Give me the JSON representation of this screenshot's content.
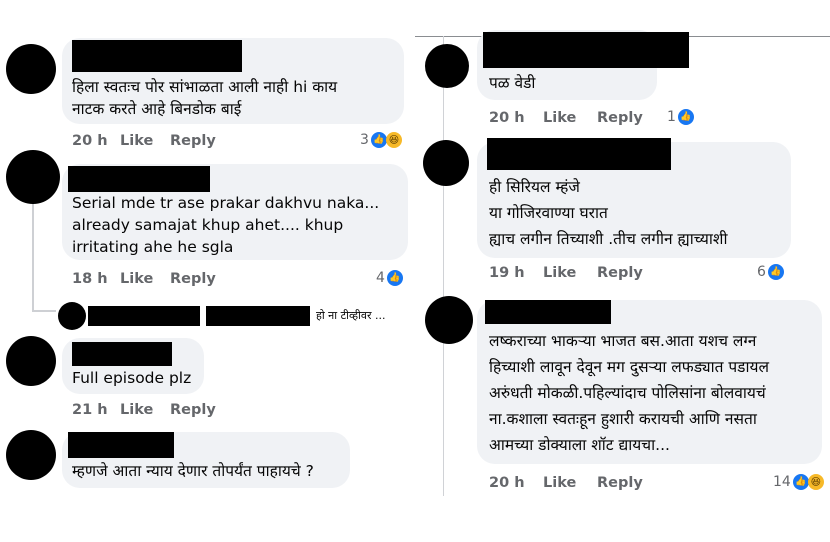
{
  "actions": {
    "like": "Like",
    "reply": "Reply"
  },
  "icons": {
    "like": "like-reaction-icon",
    "haha": "haha-reaction-icon"
  },
  "left_comments": [
    {
      "lines": [
        "हिला स्वतःच पोर सांभाळता आली नाही hi काय",
        "नाटक करते आहे बिनडोक बाई"
      ],
      "time": "20 h",
      "reactions": "3"
    },
    {
      "lines": [
        "Serial mde tr ase prakar dakhvu naka...",
        "already samajat khup ahet.... khup",
        "irritating ahe he sgla"
      ],
      "time": "18 h",
      "reactions": "4"
    },
    {
      "reply_snippet": "हो ना टीव्हीवर ..."
    },
    {
      "lines": [
        "Full episode plz"
      ],
      "time": "21 h"
    },
    {
      "lines": [
        "म्हणजे आता न्याय देणार तोपर्यंत पाहायचे ?"
      ]
    }
  ],
  "right_comments": [
    {
      "lines": [
        "पळ वेडी"
      ],
      "time": "20 h",
      "reactions": "1"
    },
    {
      "lines": [
        "ही सिरियल म्हंजे",
        "या गोजिरवाण्या घरात",
        "ह्याच लगीन तिच्याशी .तीच लगीन ह्याच्याशी"
      ],
      "time": "19 h",
      "reactions": "6"
    },
    {
      "lines": [
        "लष्कराच्या भाकऱ्या भाजत बस.आता यशच लग्न",
        "हिच्याशी लावून देवून मग दुसऱ्या लफड्यात पडायल",
        "अरुंधती मोकळी.पहिल्यांदाच पोलिसांना बोलवायचं",
        "ना.कशाला स्वतःहून हुशारी करायची आणि नसता",
        "आमच्या डोक्याला शॉट द्यायचा..."
      ],
      "time": "20 h",
      "reactions": "14"
    }
  ]
}
